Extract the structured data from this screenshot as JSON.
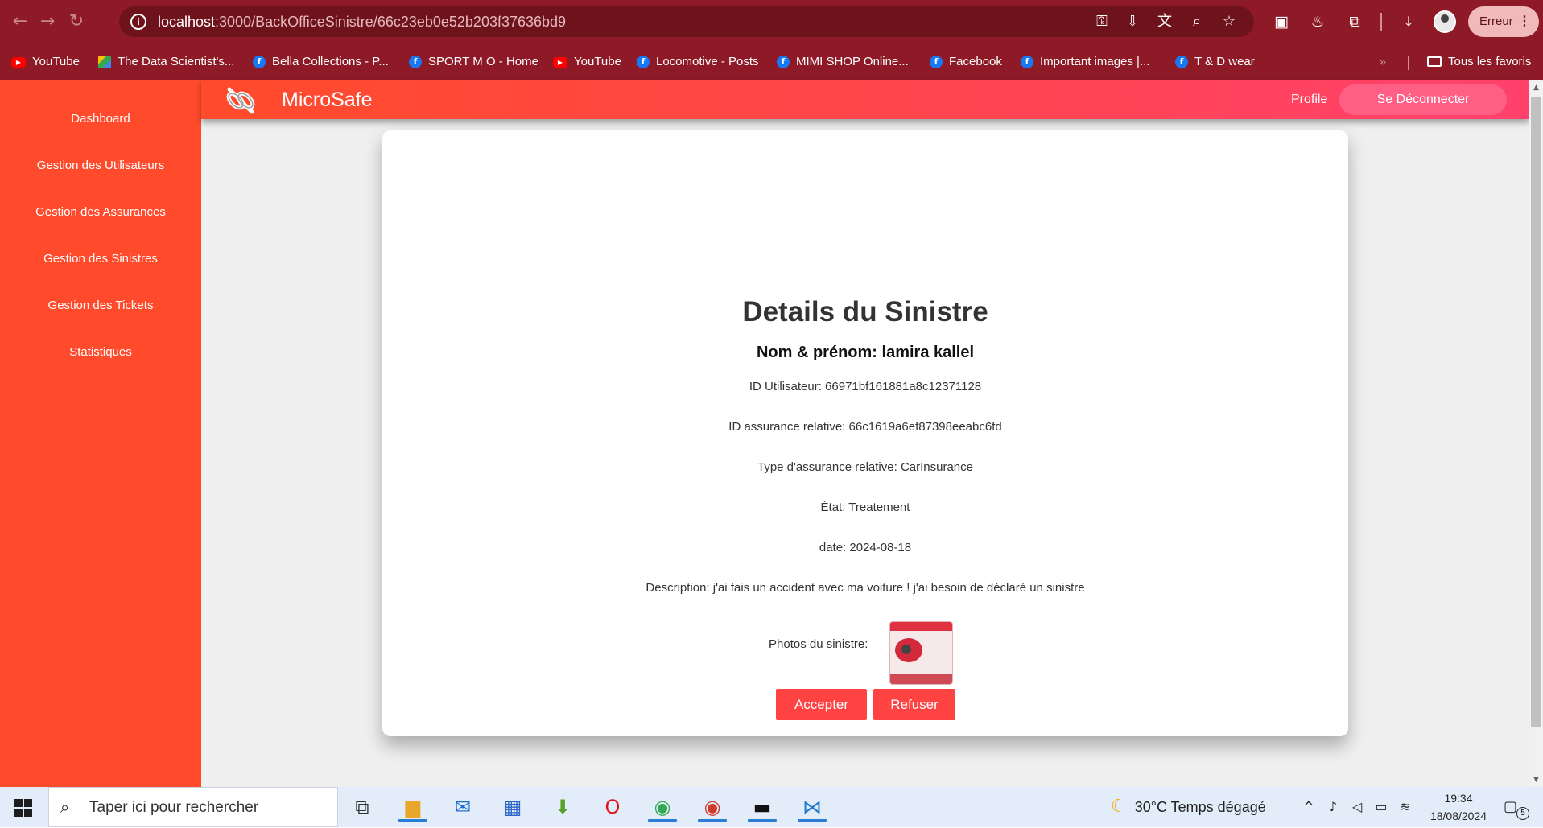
{
  "browser": {
    "url_host": "localhost",
    "url_rest": ":3000/BackOfficeSinistre/66c23eb0e52b203f37636bd9",
    "profile_status": "Erreur",
    "bookmarks": [
      {
        "label": "YouTube",
        "icon": "youtube-icon"
      },
      {
        "label": "The Data Scientist's...",
        "icon": "google-drive-icon"
      },
      {
        "label": "Bella Collections - P...",
        "icon": "facebook-icon"
      },
      {
        "label": "SPORT M O - Home",
        "icon": "facebook-icon"
      },
      {
        "label": "YouTube",
        "icon": "youtube-icon"
      },
      {
        "label": "Locomotive - Posts",
        "icon": "facebook-icon"
      },
      {
        "label": "MIMI SHOP Online...",
        "icon": "facebook-icon"
      },
      {
        "label": "Facebook",
        "icon": "facebook-icon"
      },
      {
        "label": "Important images |...",
        "icon": "facebook-icon"
      },
      {
        "label": "T & D wear",
        "icon": "facebook-icon"
      }
    ],
    "all_bookmarks_label": "Tous les favoris"
  },
  "sidebar": {
    "items": [
      {
        "label": "Dashboard"
      },
      {
        "label": "Gestion des Utilisateurs"
      },
      {
        "label": "Gestion des Assurances"
      },
      {
        "label": "Gestion des Sinistres"
      },
      {
        "label": "Gestion des Tickets"
      },
      {
        "label": "Statistiques"
      }
    ]
  },
  "header": {
    "app_name": "MicroSafe",
    "profile_label": "Profile",
    "logout_label": "Se Déconnecter"
  },
  "detail": {
    "title": "Details du Sinistre",
    "name_line": "Nom & prénom: lamira kallel",
    "user_id_line": "ID Utilisateur: 66971bf161881a8c12371128",
    "insurance_id_line": "ID assurance relative: 66c1619a6ef87398eeabc6fd",
    "insurance_type_line": "Type d'assurance relative: CarInsurance",
    "state_line": "État: Treatement",
    "date_line": "date: 2024-08-18",
    "description_line": "Description: j'ai fais un accident avec ma voiture ! j'ai besoin de déclaré un sinistre",
    "photos_label": "Photos du sinistre:",
    "accept_label": "Accepter",
    "refuse_label": "Refuser"
  },
  "taskbar": {
    "search_placeholder": "Taper ici pour rechercher",
    "weather_temp": "30°C",
    "weather_text": "Temps dégagé",
    "time": "19:34",
    "date": "18/08/2024",
    "notification_count": "5"
  },
  "colors": {
    "chrome": "#8d1a26",
    "sidebar": "#ff4b2b",
    "header_gradient_end": "#ff416c",
    "button": "#ff4343"
  }
}
